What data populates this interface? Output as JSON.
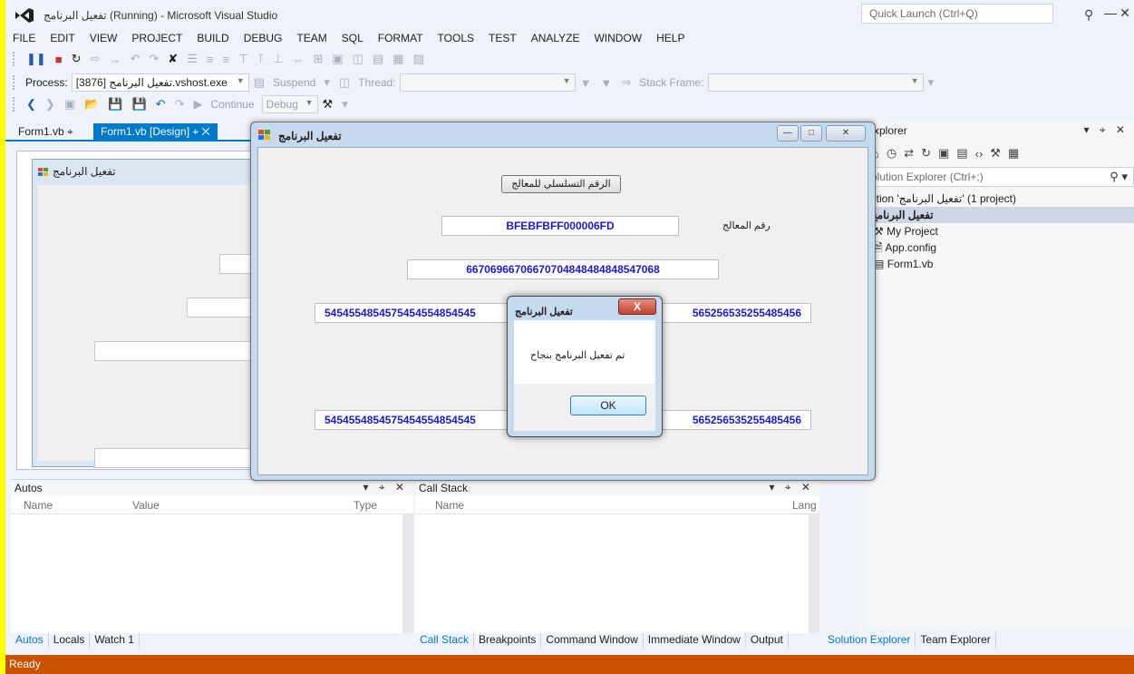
{
  "window": {
    "title": "تفعيل البرنامج (Running) - Microsoft Visual Studio",
    "quick_launch_placeholder": "Quick Launch (Ctrl+Q)"
  },
  "menu": [
    "FILE",
    "EDIT",
    "VIEW",
    "PROJECT",
    "BUILD",
    "DEBUG",
    "TEAM",
    "SQL",
    "FORMAT",
    "TOOLS",
    "TEST",
    "ANALYZE",
    "WINDOW",
    "HELP"
  ],
  "debug_location": {
    "process_label": "Process:",
    "process_value": "[3876] تفعيل البرنامج.vshost.exe",
    "suspend_label": "Suspend",
    "thread_label": "Thread:",
    "stack_frame_label": "Stack Frame:"
  },
  "standard_toolbar": {
    "continue_label": "Continue",
    "config_value": "Debug"
  },
  "doc_tabs": {
    "form1_vb": "Form1.vb",
    "form1_design": "Form1.vb [Design]"
  },
  "designer": {
    "form_title": "تفعيل البرنامج"
  },
  "solution_explorer": {
    "header": "Explorer",
    "search_placeholder": "olution Explorer (Ctrl+;)",
    "items": [
      "ution 'تفعيل البرنامج' (1 project)",
      "تفعيل البرنامج",
      "My Project",
      "App.config",
      "Form1.vb"
    ]
  },
  "running_form": {
    "title": "تفعيل البرنامج",
    "serial_button": "الرقم التسلسلي للمعالج",
    "processor_label": "رقم المعالج",
    "processor_id": "BFEBFBFF000006FD",
    "code_1": "66706966706670704848484848547068",
    "code_2_left": "5454554854575454554854545",
    "code_2_right": "565256535255485456",
    "code_3_left": "5454554854575454554854545",
    "code_3_right": "565256535255485456"
  },
  "message_box": {
    "title": "تفعيل البرنامج",
    "close": "X",
    "text": "تم تفعيل البرنامج بنجاح",
    "ok": "OK"
  },
  "autos_panel": {
    "title": "Autos",
    "col_name": "Name",
    "col_value": "Value",
    "col_type": "Type"
  },
  "callstack_panel": {
    "title": "Call Stack",
    "col_name": "Name",
    "col_lang": "Lang"
  },
  "bottom_tabs_left": [
    "Autos",
    "Locals",
    "Watch 1"
  ],
  "bottom_tabs_mid": [
    "Call Stack",
    "Breakpoints",
    "Command Window",
    "Immediate Window",
    "Output"
  ],
  "bottom_tabs_right": [
    "Solution Explorer",
    "Team Explorer"
  ],
  "status": "Ready",
  "colors": {
    "accent": "#007acc",
    "status_bar": "#ca5100",
    "code_text": "#1a1ad1"
  }
}
